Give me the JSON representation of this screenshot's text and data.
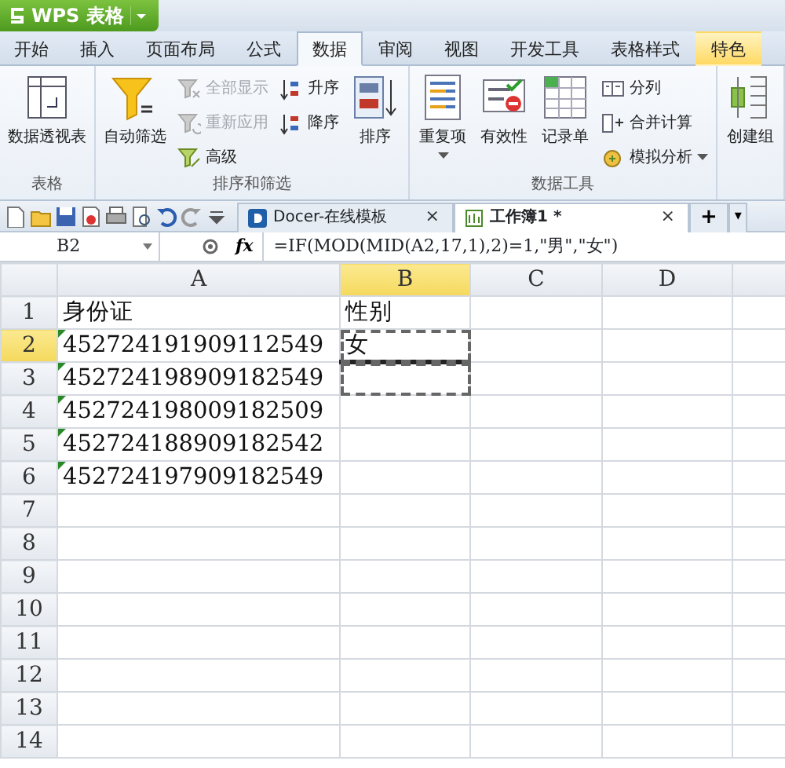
{
  "app_button": {
    "label": "WPS 表格"
  },
  "menu_tabs": [
    {
      "label": "开始",
      "selected": false,
      "kind": "normal"
    },
    {
      "label": "插入",
      "selected": false,
      "kind": "normal"
    },
    {
      "label": "页面布局",
      "selected": false,
      "kind": "normal"
    },
    {
      "label": "公式",
      "selected": false,
      "kind": "normal"
    },
    {
      "label": "数据",
      "selected": true,
      "kind": "normal"
    },
    {
      "label": "审阅",
      "selected": false,
      "kind": "normal"
    },
    {
      "label": "视图",
      "selected": false,
      "kind": "normal"
    },
    {
      "label": "开发工具",
      "selected": false,
      "kind": "normal"
    },
    {
      "label": "表格样式",
      "selected": false,
      "kind": "normal"
    },
    {
      "label": "特色",
      "selected": false,
      "kind": "special"
    }
  ],
  "ribbon_groups": [
    {
      "label": "表格",
      "items": [
        {
          "kind": "large",
          "label": "数据透视表",
          "dropdown": false
        }
      ]
    },
    {
      "label": "排序和筛选",
      "items": [
        {
          "kind": "large",
          "label": "自动筛选",
          "dropdown": false
        },
        {
          "kind": "stack",
          "items": [
            {
              "label": "全部显示",
              "disabled": true
            },
            {
              "label": "重新应用",
              "disabled": true
            },
            {
              "label": "高级",
              "disabled": false
            }
          ]
        },
        {
          "kind": "stack",
          "items": [
            {
              "label": "升序",
              "disabled": false
            },
            {
              "label": "降序",
              "disabled": false
            }
          ]
        },
        {
          "kind": "large",
          "label": "排序",
          "dropdown": false
        }
      ]
    },
    {
      "label": "数据工具",
      "items": [
        {
          "kind": "large",
          "label": "重复项",
          "dropdown": true
        },
        {
          "kind": "large",
          "label": "有效性",
          "dropdown": false
        },
        {
          "kind": "large",
          "label": "记录单",
          "dropdown": false
        },
        {
          "kind": "stack",
          "items": [
            {
              "label": "分列",
              "disabled": false
            },
            {
              "label": "合并计算",
              "disabled": false
            },
            {
              "label": "模拟分析",
              "disabled": false,
              "dropdown": true
            }
          ]
        }
      ]
    },
    {
      "items": [
        {
          "kind": "large",
          "label": "创建组",
          "dropdown": false
        }
      ]
    }
  ],
  "doc_tabs": [
    {
      "label": "Docer-在线模板",
      "close": "×",
      "selected": false
    },
    {
      "label": "工作簿1 *",
      "close": "×",
      "selected": true
    }
  ],
  "new_tab_button": "+",
  "tab_menu_button": "▾",
  "name_box": "B2",
  "fx_label": "fx",
  "formula": "=IF(MOD(MID(A2,17,1),2)=1,\"男\",\"女\")",
  "columns": [
    {
      "label": "A",
      "selected": false
    },
    {
      "label": "B",
      "selected": true
    },
    {
      "label": "C",
      "selected": false
    },
    {
      "label": "D",
      "selected": false
    }
  ],
  "rows": [
    {
      "label": "1",
      "selected": false,
      "cells": [
        {
          "text": "身份证",
          "flagged": false,
          "selected": false
        },
        {
          "text": "性别",
          "flagged": false,
          "selected": false
        }
      ]
    },
    {
      "label": "2",
      "selected": true,
      "cells": [
        {
          "text": "452724191909112549",
          "flagged": true,
          "selected": false
        },
        {
          "text": "女",
          "flagged": false,
          "selected": true
        }
      ]
    },
    {
      "label": "3",
      "selected": false,
      "cells": [
        {
          "text": "452724198909182549",
          "flagged": true,
          "selected": false
        },
        {
          "flagged": false,
          "selected": true
        }
      ]
    },
    {
      "label": "4",
      "selected": false,
      "cells": [
        {
          "text": "452724198009182509",
          "flagged": true,
          "selected": false
        }
      ]
    },
    {
      "label": "5",
      "selected": false,
      "cells": [
        {
          "text": "452724188909182542",
          "flagged": true,
          "selected": false
        }
      ]
    },
    {
      "label": "6",
      "selected": false,
      "cells": [
        {
          "text": "452724197909182549",
          "flagged": true,
          "selected": false
        }
      ]
    },
    {
      "label": "7",
      "selected": false,
      "cells": []
    },
    {
      "label": "8",
      "selected": false,
      "cells": []
    },
    {
      "label": "9",
      "selected": false,
      "cells": []
    },
    {
      "label": "10",
      "selected": false,
      "cells": []
    },
    {
      "label": "11",
      "selected": false,
      "cells": []
    },
    {
      "label": "12",
      "selected": false,
      "cells": []
    },
    {
      "label": "13",
      "selected": false,
      "cells": []
    },
    {
      "label": "14",
      "selected": false,
      "cells": []
    }
  ]
}
